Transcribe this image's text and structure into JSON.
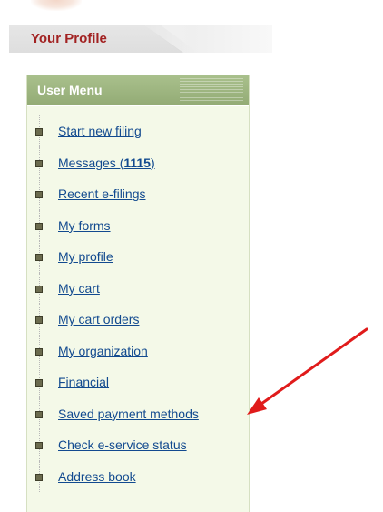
{
  "profile_tab": {
    "label": "Your Profile"
  },
  "user_menu": {
    "title": "User Menu",
    "items": [
      {
        "label": "Start new filing"
      },
      {
        "label": "Messages (",
        "count": "1115",
        "suffix": ")"
      },
      {
        "label": "Recent e-filings"
      },
      {
        "label": "My forms"
      },
      {
        "label": "My profile"
      },
      {
        "label": "My cart"
      },
      {
        "label": "My cart orders"
      },
      {
        "label": "My organization"
      },
      {
        "label": "Financial"
      },
      {
        "label": "Saved payment methods"
      },
      {
        "label": "Check e-service status"
      },
      {
        "label": "Address book"
      }
    ]
  },
  "annotation": {
    "arrow_color": "#e01b1b",
    "points_to": "Saved payment methods"
  },
  "colors": {
    "profile_tab_text": "#a22222",
    "menu_header": "#9db580",
    "menu_background": "#f4f9e8",
    "link": "#124a8f"
  }
}
